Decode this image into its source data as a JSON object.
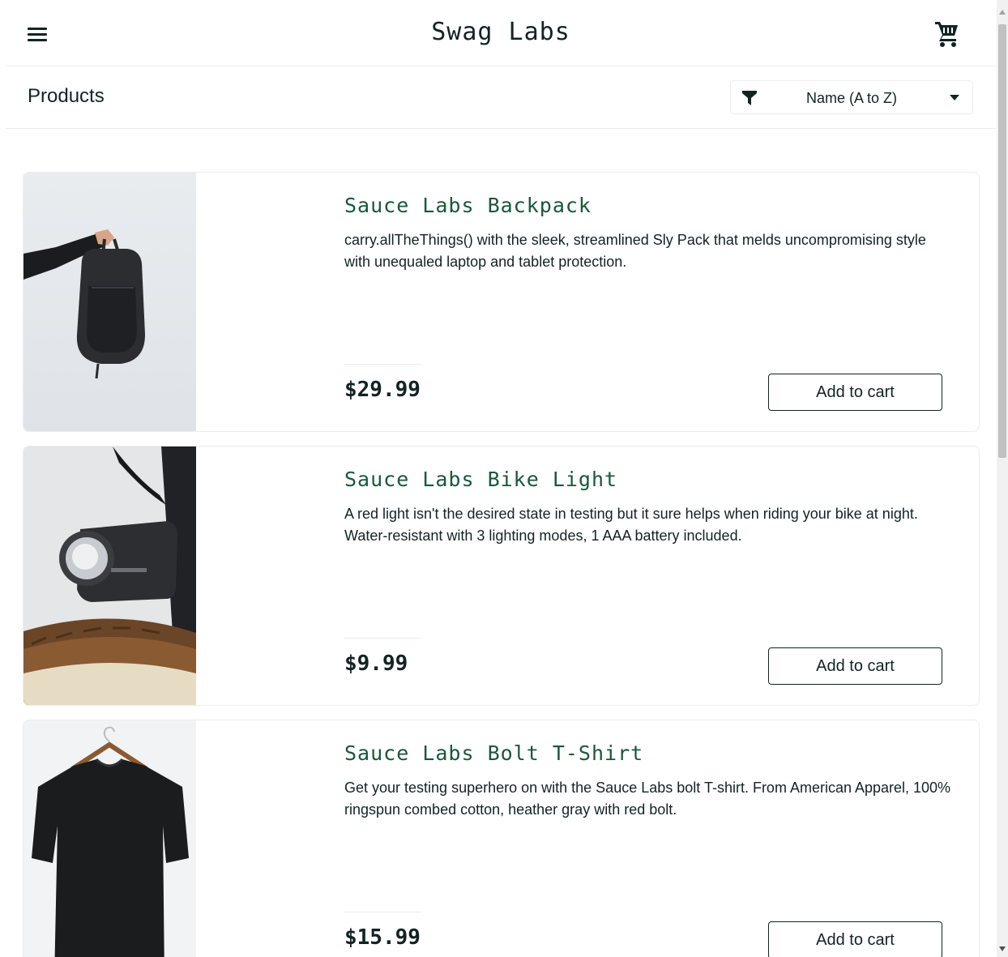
{
  "app": {
    "title": "Swag Labs"
  },
  "header": {
    "menu_icon": "hamburger-menu-icon",
    "cart_icon": "shopping-cart-icon"
  },
  "sub_header": {
    "title": "Products",
    "sort": {
      "selected": "Name (A to Z)",
      "filter_icon": "filter-icon",
      "caret_icon": "caret-down-icon"
    }
  },
  "colors": {
    "item_name": "#18583a",
    "text": "#132322",
    "border": "#ededed"
  },
  "products": [
    {
      "name": "Sauce Labs Backpack",
      "description": "carry.allTheThings() with the sleek, streamlined Sly Pack that melds uncompromising style with unequaled laptop and tablet protection.",
      "price": "$29.99",
      "button": "Add to cart",
      "image": "backpack"
    },
    {
      "name": "Sauce Labs Bike Light",
      "description": "A red light isn't the desired state in testing but it sure helps when riding your bike at night. Water-resistant with 3 lighting modes, 1 AAA battery included.",
      "price": "$9.99",
      "button": "Add to cart",
      "image": "bike-light"
    },
    {
      "name": "Sauce Labs Bolt T-Shirt",
      "description": "Get your testing superhero on with the Sauce Labs bolt T-shirt. From American Apparel, 100% ringspun combed cotton, heather gray with red bolt.",
      "price": "$15.99",
      "button": "Add to cart",
      "image": "t-shirt"
    }
  ]
}
